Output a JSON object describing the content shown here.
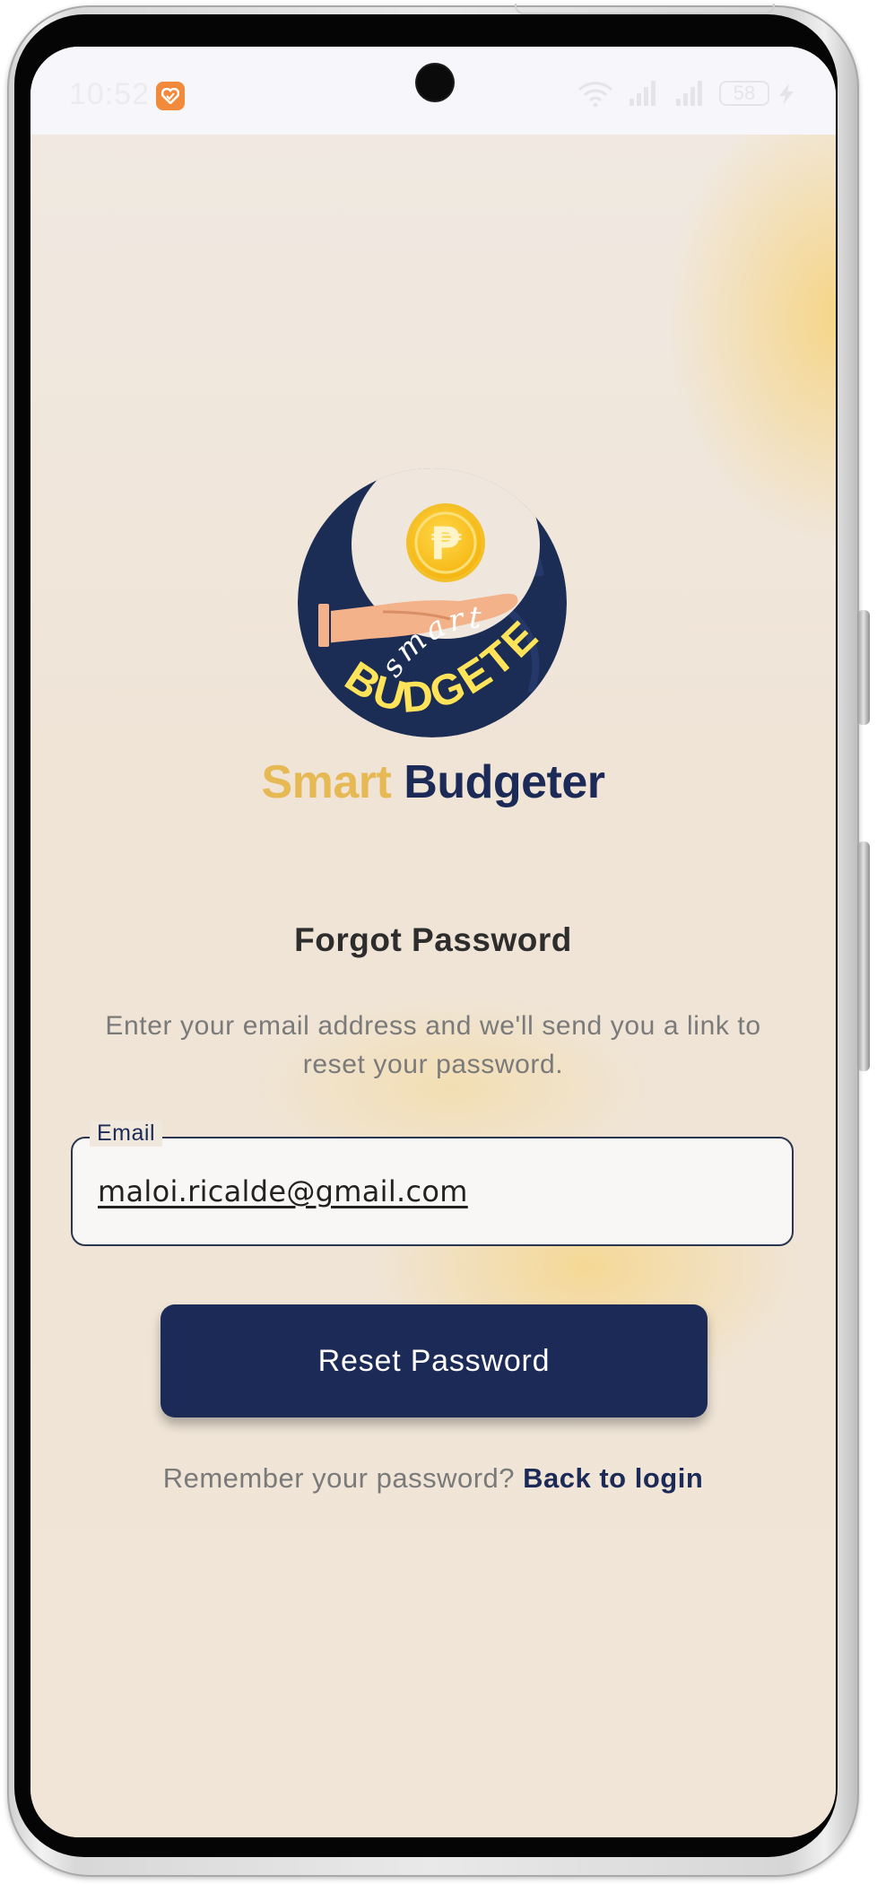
{
  "status_bar": {
    "time": "10:52",
    "battery": "58",
    "icons": [
      "heart-app-icon",
      "wifi-icon",
      "signal-icon",
      "signal-icon",
      "battery-icon",
      "charging-bolt-icon"
    ]
  },
  "brand": {
    "logo_top_text": "smart",
    "logo_bottom_text": "BUDGETER",
    "logo_coin_symbol": "₱",
    "title_part1": "Smart",
    "title_part2": "Budgeter",
    "accent_color": "#e7b955",
    "primary_color": "#1c2a57"
  },
  "forgot_password": {
    "heading": "Forgot Password",
    "instructions": "Enter your email address and we'll send you a link to reset your password.",
    "email_label": "Email",
    "email_value": "maloi.ricalde@gmail.com",
    "reset_button_label": "Reset Password",
    "remember_prompt": "Remember your password?",
    "back_link_label": "Back to login"
  }
}
